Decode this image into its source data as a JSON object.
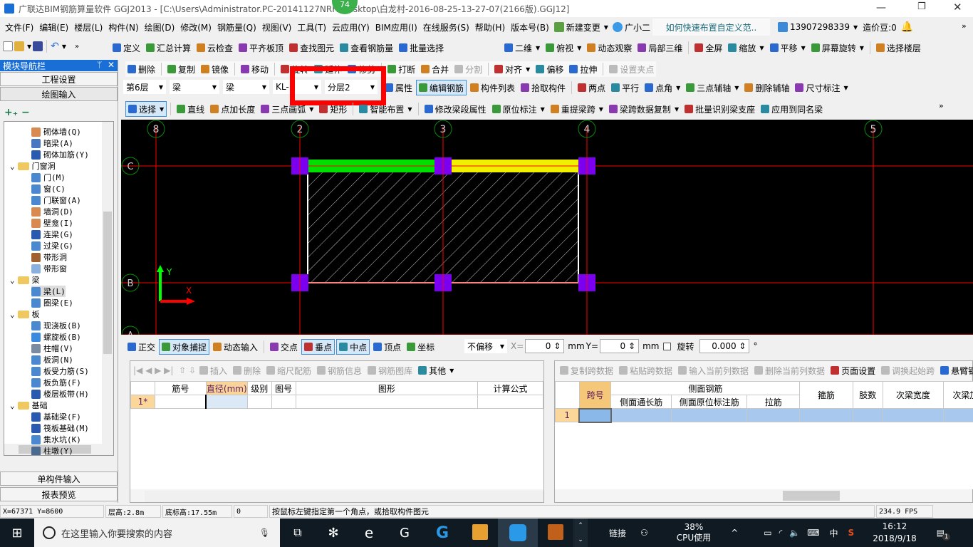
{
  "title": {
    "text": "广联达BIM钢筋算量软件 GGJ2013 - [C:\\Users\\Administrator.PC-20141127NRH\\Desktop\\白龙村-2016-08-25-13-27-07(2166版).GGJ12]",
    "badge": "74"
  },
  "menu": [
    "文件(F)",
    "编辑(E)",
    "楼层(L)",
    "构件(N)",
    "绘图(D)",
    "修改(M)",
    "钢筋量(Q)",
    "视图(V)",
    "工具(T)",
    "云应用(Y)",
    "BIM应用(I)",
    "在线服务(S)",
    "帮助(H)",
    "版本号(B)"
  ],
  "menu_extra": {
    "new_change": "新建变更",
    "assistant": "广小二",
    "tip": "如何快速布置自定义范..",
    "account": "13907298339",
    "beans": "造价豆:0"
  },
  "toolbar1": [
    "定义",
    "汇总计算",
    "云检查",
    "平齐板顶",
    "查找图元",
    "查看钢筋量",
    "批量选择"
  ],
  "toolbar1_right": [
    "二维",
    "俯视",
    "动态观察",
    "局部三维",
    "全屏",
    "缩放",
    "平移",
    "屏幕旋转",
    "选择楼层"
  ],
  "toolbar2": [
    "删除",
    "复制",
    "镜像",
    "移动",
    "旋转",
    "延伸",
    "修剪",
    "打断",
    "合并",
    "分割",
    "对齐",
    "偏移",
    "拉伸",
    "设置夹点"
  ],
  "selectors": {
    "floor": "第6层",
    "type": "梁",
    "subtype": "梁",
    "name": "KL-",
    "layer": "分层2"
  },
  "toolbar3": [
    "属性",
    "编辑钢筋",
    "构件列表",
    "拾取构件",
    "两点",
    "平行",
    "点角",
    "三点辅轴",
    "删除辅轴",
    "尺寸标注"
  ],
  "toolbar4": [
    "选择",
    "直线",
    "点加长度",
    "三点画弧",
    "矩形",
    "智能布置",
    "修改梁段属性",
    "原位标注",
    "重提梁跨",
    "梁跨数据复制",
    "批量识别梁支座",
    "应用到同名梁"
  ],
  "nav": {
    "title": "模块导航栏",
    "project_settings": "工程设置",
    "draw_input": "绘图输入",
    "single_input": "单构件输入",
    "report": "报表预览"
  },
  "tree": [
    {
      "label": "砌体墙(Q)",
      "level": 2,
      "color": "#d98a50"
    },
    {
      "label": "暗梁(A)",
      "level": 2,
      "color": "#4a78c0"
    },
    {
      "label": "砌体加筋(Y)",
      "level": 2,
      "color": "#2a5ab0"
    },
    {
      "label": "门窗洞",
      "level": 1,
      "folder": true
    },
    {
      "label": "门(M)",
      "level": 2,
      "color": "#4a88d0"
    },
    {
      "label": "窗(C)",
      "level": 2,
      "color": "#4a88d0"
    },
    {
      "label": "门联窗(A)",
      "level": 2,
      "color": "#4a88d0"
    },
    {
      "label": "墙洞(D)",
      "level": 2,
      "color": "#d98a50"
    },
    {
      "label": "壁龛(I)",
      "level": 2,
      "color": "#d98a50"
    },
    {
      "label": "连梁(G)",
      "level": 2,
      "color": "#2a5ab0"
    },
    {
      "label": "过梁(G)",
      "level": 2,
      "color": "#4a88d0"
    },
    {
      "label": "带形洞",
      "level": 2,
      "color": "#a06030"
    },
    {
      "label": "带形窗",
      "level": 2,
      "color": "#8ab0e0"
    },
    {
      "label": "梁",
      "level": 1,
      "folder": true
    },
    {
      "label": "梁(L)",
      "level": 2,
      "color": "#4a88d0",
      "selected": true
    },
    {
      "label": "圈梁(E)",
      "level": 2,
      "color": "#4a88d0"
    },
    {
      "label": "板",
      "level": 1,
      "folder": true
    },
    {
      "label": "现浇板(B)",
      "level": 2,
      "color": "#4a88d0"
    },
    {
      "label": "螺旋板(B)",
      "level": 2,
      "color": "#3a8ae0"
    },
    {
      "label": "柱帽(V)",
      "level": 2,
      "color": "#7a8aa0"
    },
    {
      "label": "板洞(N)",
      "level": 2,
      "color": "#4a88d0"
    },
    {
      "label": "板受力筋(S)",
      "level": 2,
      "color": "#4a88d0"
    },
    {
      "label": "板负筋(F)",
      "level": 2,
      "color": "#4a88d0"
    },
    {
      "label": "楼层板带(H)",
      "level": 2,
      "color": "#2a5ab0"
    },
    {
      "label": "基础",
      "level": 1,
      "folder": true
    },
    {
      "label": "基础梁(F)",
      "level": 2,
      "color": "#2a5ab0"
    },
    {
      "label": "筏板基础(M)",
      "level": 2,
      "color": "#2a5ab0"
    },
    {
      "label": "集水坑(K)",
      "level": 2,
      "color": "#4a88d0"
    },
    {
      "label": "柱墩(Y)",
      "level": 2,
      "color": "#4a6a90"
    }
  ],
  "canvas": {
    "axes_x": [
      "8",
      "2",
      "3",
      "4",
      "5"
    ],
    "axes_y": [
      "C",
      "B",
      "A"
    ],
    "x_label": "X",
    "y_label": "Y",
    "colors": {
      "grid": "#ff0000",
      "column": "#7b00f0",
      "beam1": "#00e000",
      "beam2": "#f0f000",
      "highlight": "#ff0000"
    }
  },
  "snapbar": {
    "items": [
      "正交",
      "对象捕捉",
      "动态输入",
      "交点",
      "垂点",
      "中点",
      "顶点",
      "坐标"
    ],
    "offset": "不偏移",
    "x_label": "X=",
    "x": "0",
    "y_label": "Y=",
    "y": "0",
    "unit": "mm",
    "rotate": "旋转",
    "rotate_val": "0.000",
    "deg": "°"
  },
  "rebar_panel": {
    "toolbar": [
      "插入",
      "删除",
      "缩尺配筋",
      "钢筋信息",
      "钢筋图库",
      "其他"
    ],
    "columns": [
      "",
      "筋号",
      "直径(mm)",
      "级别",
      "图号",
      "图形",
      "计算公式"
    ],
    "rows": [
      [
        "1*",
        "",
        "",
        "",
        "",
        "",
        ""
      ]
    ]
  },
  "span_panel": {
    "toolbar": [
      "复制跨数据",
      "粘贴跨数据",
      "输入当前列数据",
      "删除当前列数据",
      "页面设置",
      "调换起始跨",
      "悬臂钢筋代号"
    ],
    "group": "侧面钢筋",
    "columns": [
      "跨号",
      "侧面通长筋",
      "侧面原位标注筋",
      "拉筋",
      "箍筋",
      "肢数",
      "次梁宽度",
      "次梁加筋"
    ],
    "rows": [
      [
        "1",
        "",
        "",
        "",
        "",
        "",
        "",
        ""
      ]
    ]
  },
  "status": {
    "coords": "X=67371 Y=8600",
    "floor_height": "层高:2.8m",
    "base_elev": "底标高:17.55m",
    "zero": "0",
    "hint": "按鼠标左键指定第一个角点，或拾取构件图元",
    "fps": "234.9 FPS"
  },
  "taskbar": {
    "search": "在这里输入你要搜索的内容",
    "link": "链接",
    "cpu": "38%",
    "cpu_label": "CPU使用",
    "ime": "中",
    "time": "16:12",
    "date": "2018/9/18",
    "notif": "1"
  }
}
